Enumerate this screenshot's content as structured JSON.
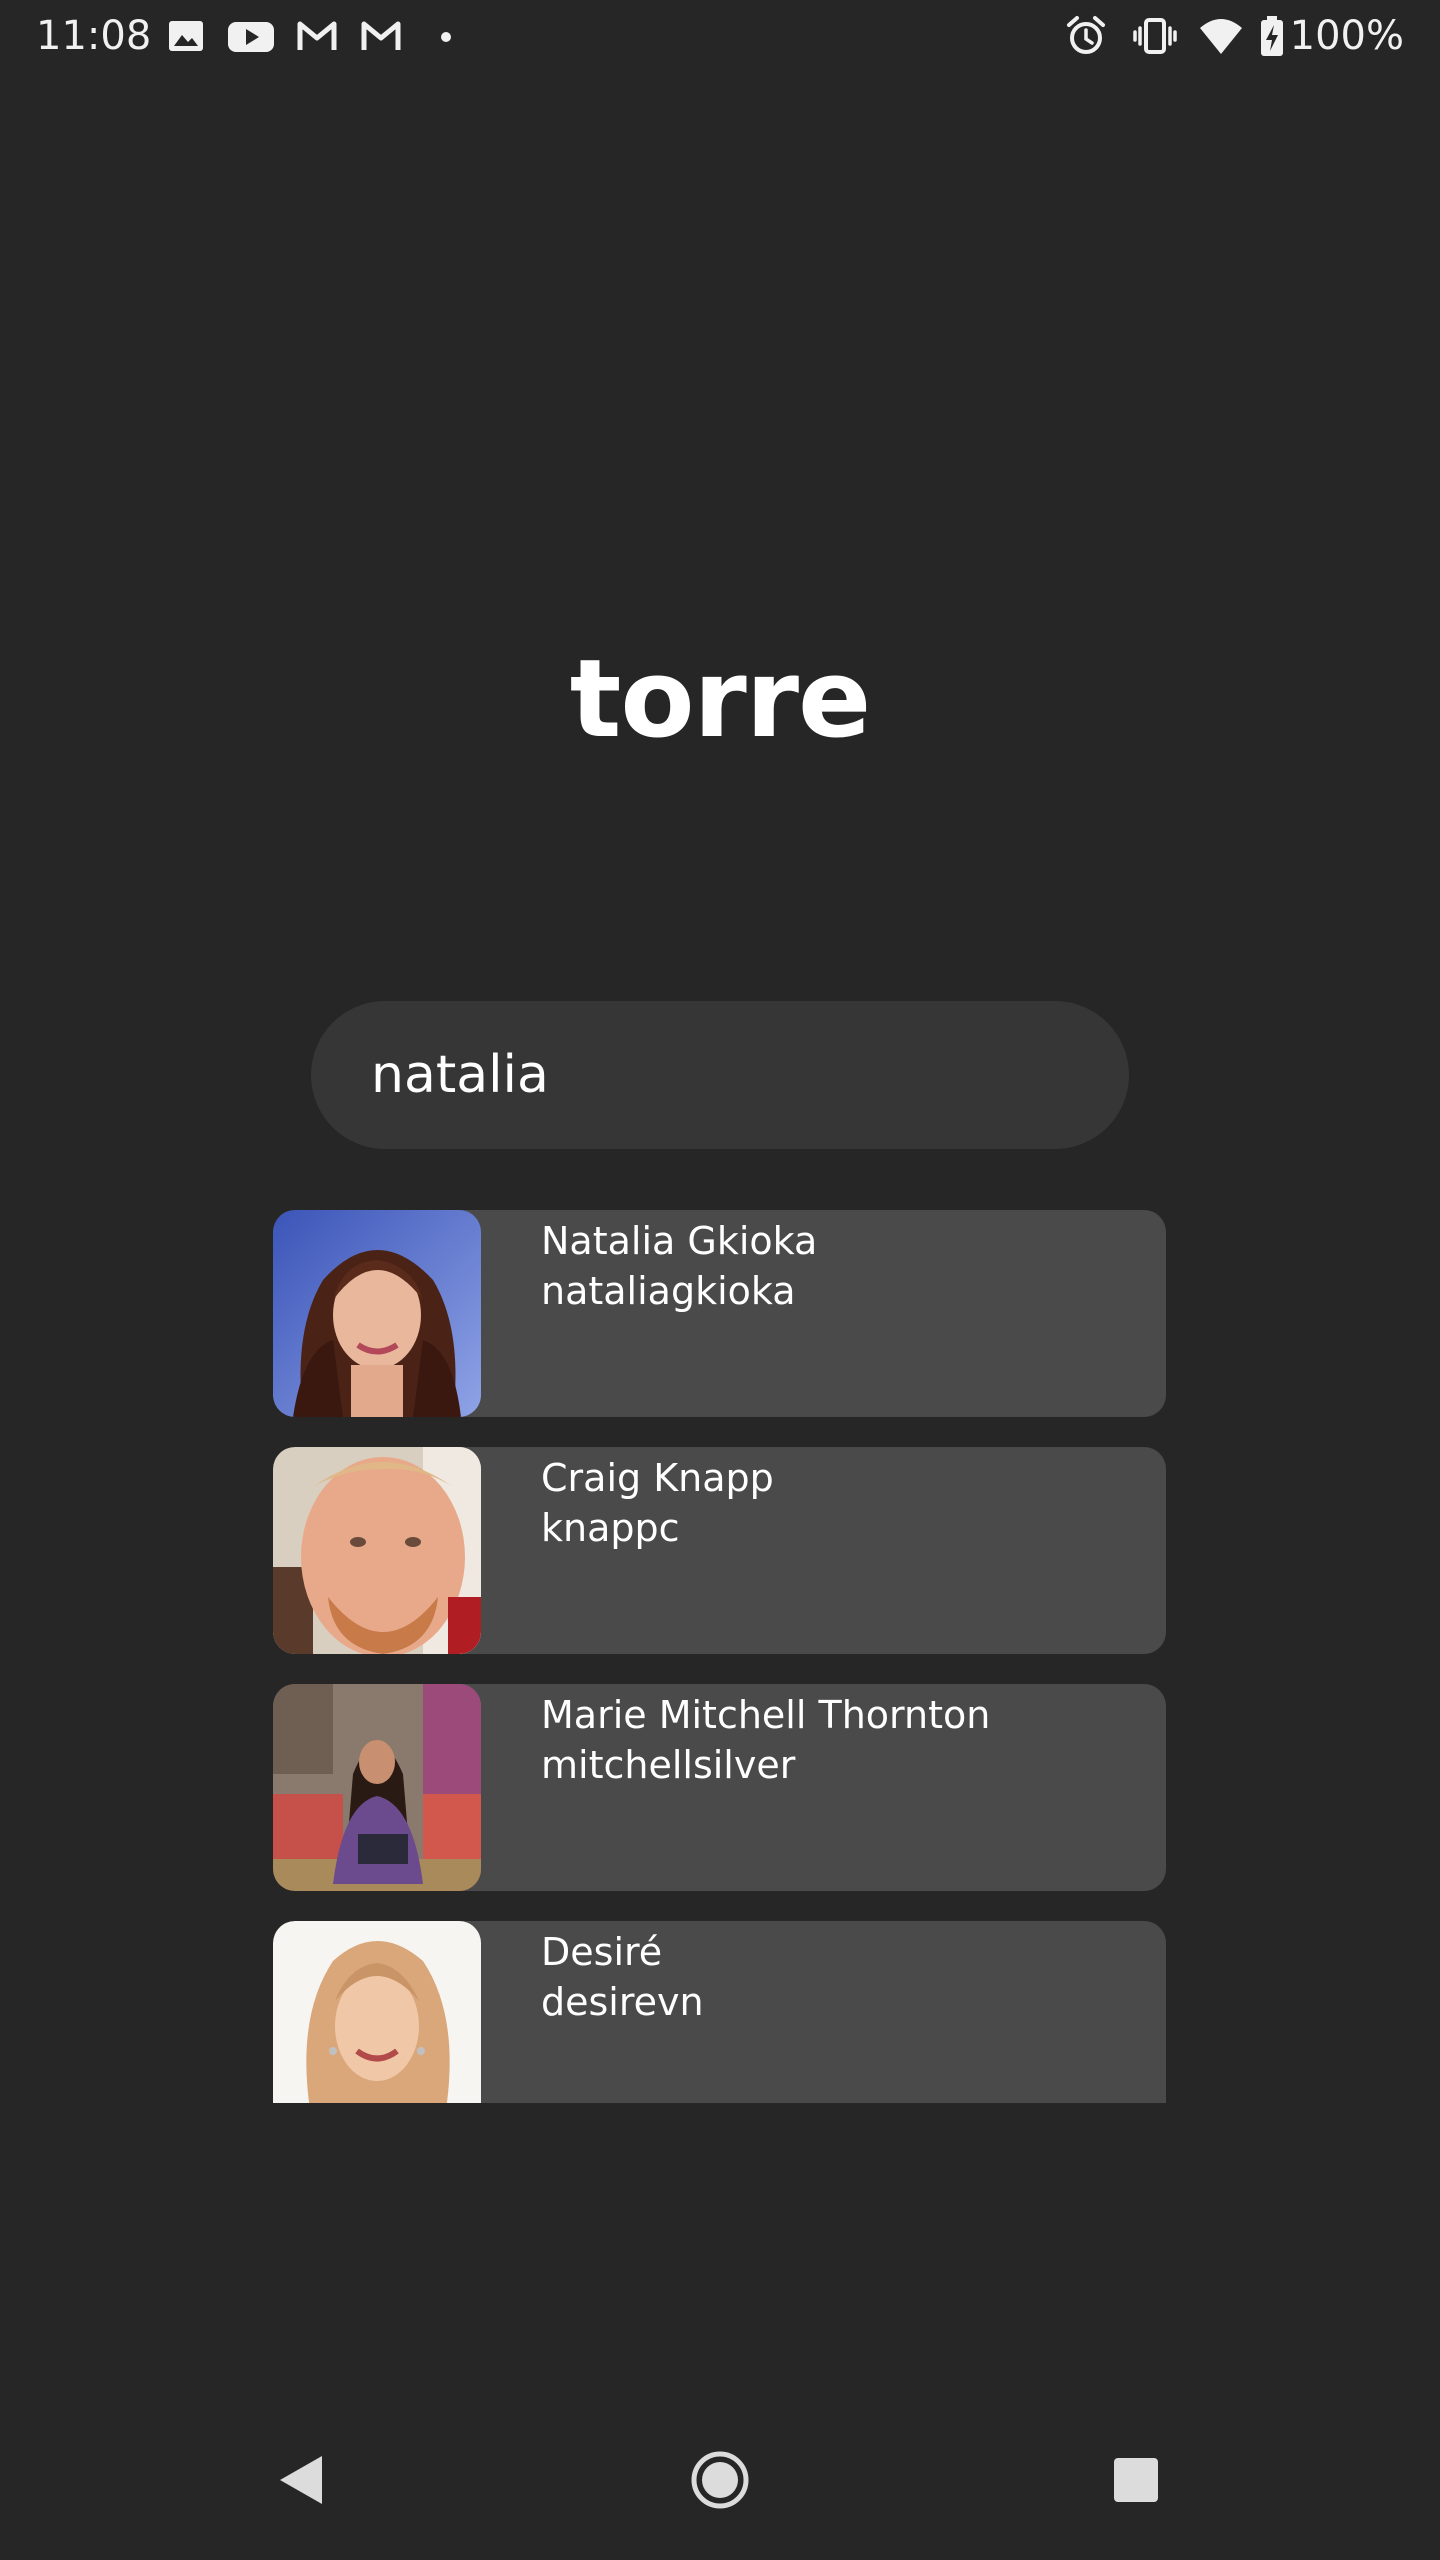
{
  "status_bar": {
    "time": "11:08",
    "battery_percent": "100%",
    "left_icons": [
      "image-icon",
      "youtube-icon",
      "gmail-icon",
      "gmail-icon",
      "dot-icon"
    ],
    "right_icons": [
      "alarm-icon",
      "vibrate-icon",
      "wifi-icon",
      "battery-charging-icon"
    ]
  },
  "app": {
    "title": "torre"
  },
  "search": {
    "value": "natalia",
    "placeholder": ""
  },
  "results": [
    {
      "name": "Natalia Gkioka",
      "handle": "nataliagkioka"
    },
    {
      "name": "Craig Knapp",
      "handle": "knappc"
    },
    {
      "name": "Marie Mitchell Thornton",
      "handle": "mitchellsilver"
    },
    {
      "name": "Desiré",
      "handle": "desirevn"
    }
  ],
  "nav_bar": {
    "buttons": [
      "back-icon",
      "home-icon",
      "recents-icon"
    ]
  },
  "colors": {
    "background": "#262627",
    "search_field": "#363637",
    "card": "#4a4a4b",
    "text": "#ffffff"
  }
}
